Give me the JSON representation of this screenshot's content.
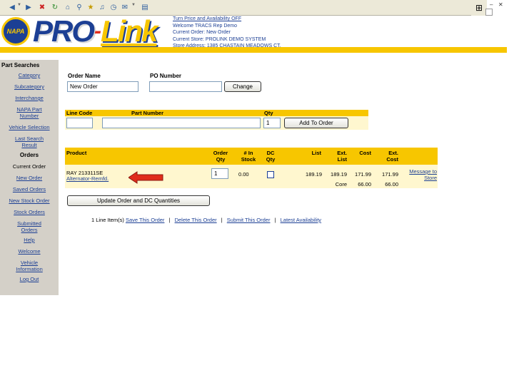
{
  "browser": {
    "icons": [
      "back-icon",
      "forward-icon",
      "stop-icon",
      "refresh-icon",
      "home-icon",
      "search-icon",
      "favorites-icon",
      "media-icon",
      "history-icon",
      "mail-icon"
    ],
    "win_min": "–",
    "win_close": "✕"
  },
  "banner": {
    "logo_text": "NAPA",
    "brand_pro": "PRO",
    "brand_dash": "-",
    "brand_link": "Link",
    "price_link": "Turn Price and Availability OFF",
    "welcome": "Welcome TRACS Rep Demo",
    "current_order": "Current Order: New Order",
    "current_store": "Current Store: PROLINK DEMO SYSTEM",
    "store_address": "Store Address: 1385 CHASTAIN MEADOWS CT."
  },
  "sidebar": {
    "part_searches_title": "Part Searches",
    "search_items": [
      "Category",
      "Subcategory",
      "Interchange",
      "NAPA Part Number",
      "Vehicle Selection",
      "Last Search Result"
    ],
    "orders_title": "Orders",
    "current_order": "Current Order",
    "order_items": [
      "New Order",
      "Saved Orders",
      "New Stock Order",
      "Stock Orders",
      "Submitted Orders",
      "Help",
      "Welcome",
      "Vehicle Information",
      "Log Out"
    ]
  },
  "order_form": {
    "order_name_label": "Order Name",
    "order_name_value": "New Order",
    "po_number_label": "PO Number",
    "po_number_value": "",
    "change_button": "Change"
  },
  "add_form": {
    "line_code_label": "Line Code",
    "part_number_label": "Part Number",
    "qty_label": "Qty",
    "line_code_value": "",
    "part_number_value": "",
    "qty_value": "1",
    "add_button": "Add To Order"
  },
  "order_table": {
    "headers": {
      "product": "Product",
      "order_qty": "Order Qty",
      "in_stock": "# In Stock",
      "dc_qty": "DC Qty",
      "list": "List",
      "ext_list": "Ext. List",
      "cost": "Cost",
      "ext_cost": "Ext. Cost"
    },
    "row": {
      "product_code": "RAY 213311SE",
      "product_desc": "Alternator-Remfd.",
      "order_qty": "1",
      "in_stock": "0.00",
      "list": "189.19",
      "ext_list": "189.19",
      "cost": "171.99",
      "ext_cost": "171.99",
      "message_link": "Message to Store",
      "core_label": "Core",
      "core_cost": "66.00",
      "core_ext_cost": "66.00"
    },
    "update_button": "Update Order and DC Quantities"
  },
  "footer_links": {
    "line_items": "1 Line Item(s)",
    "save": "Save This Order",
    "delete": "Delete This Order",
    "submit": "Submit This Order",
    "availability": "Latest Availability",
    "separator": "|"
  },
  "colors": {
    "napa_blue": "#1c3f94",
    "napa_yellow": "#f7c600",
    "arrow_red": "#e02c1c"
  }
}
